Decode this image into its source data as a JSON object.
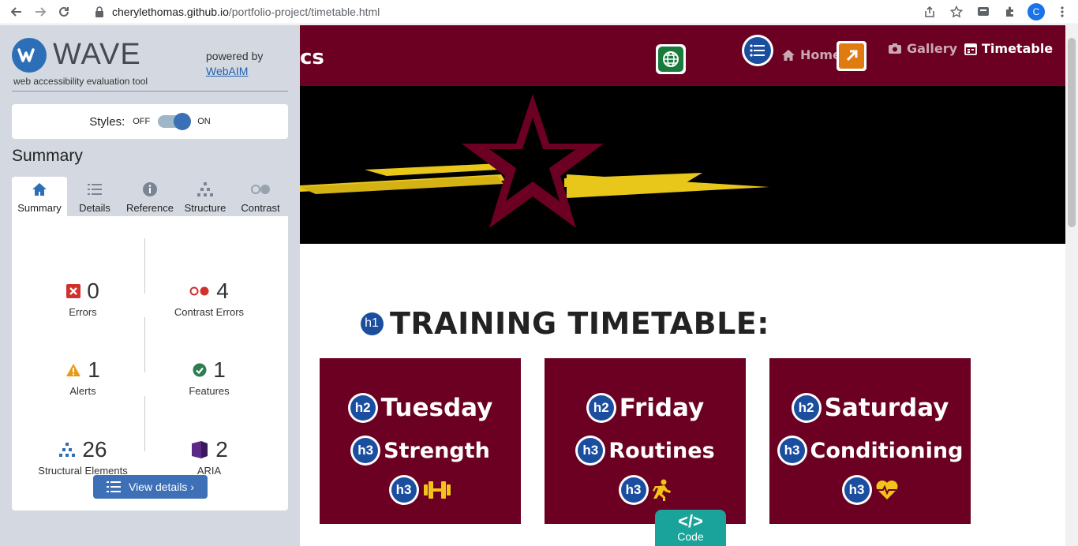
{
  "browser": {
    "url_host": "cherylethomas.github.io",
    "url_path": "/portfolio-project/timetable.html",
    "profile_initial": "C"
  },
  "wave": {
    "logo_text": "WAVE",
    "subtitle": "web accessibility evaluation tool",
    "powered_by": "powered by",
    "webaim_link": "WebAIM",
    "styles_label": "Styles:",
    "toggle_off": "OFF",
    "toggle_on": "ON",
    "summary_heading": "Summary",
    "tabs": [
      {
        "label": "Summary",
        "icon": "home-icon"
      },
      {
        "label": "Details",
        "icon": "list-icon"
      },
      {
        "label": "Reference",
        "icon": "info-icon"
      },
      {
        "label": "Structure",
        "icon": "hierarchy-icon"
      },
      {
        "label": "Contrast",
        "icon": "contrast-icon"
      }
    ],
    "stats": {
      "errors": {
        "value": "0",
        "label": "Errors"
      },
      "contrast_errors": {
        "value": "4",
        "label": "Contrast Errors"
      },
      "alerts": {
        "value": "1",
        "label": "Alerts"
      },
      "features": {
        "value": "1",
        "label": "Features"
      },
      "structural": {
        "value": "26",
        "label": "Structural Elements"
      },
      "aria": {
        "value": "2",
        "label": "ARIA"
      }
    },
    "view_details": "View details ›"
  },
  "site": {
    "brand_fragment": "cs",
    "nav": {
      "home": "Home",
      "gallery": "Gallery",
      "timetable": "Timetable"
    },
    "h1_badge": "h1",
    "page_title": "TRAINING TIMETABLE:",
    "cards": [
      {
        "day": "Tuesday",
        "type": "Strength",
        "icon": "dumbbell-icon"
      },
      {
        "day": "Friday",
        "type": "Routines",
        "icon": "running-icon"
      },
      {
        "day": "Saturday",
        "type": "Conditioning",
        "icon": "heartbeat-icon"
      }
    ],
    "h2_badge": "h2",
    "h3_badge": "h3",
    "code_tab": {
      "symbol": "</>",
      "label": "Code"
    }
  },
  "colors": {
    "maroon": "#6c0022",
    "wave_blue": "#2c6fb7",
    "star_yellow": "#e8c61a"
  }
}
